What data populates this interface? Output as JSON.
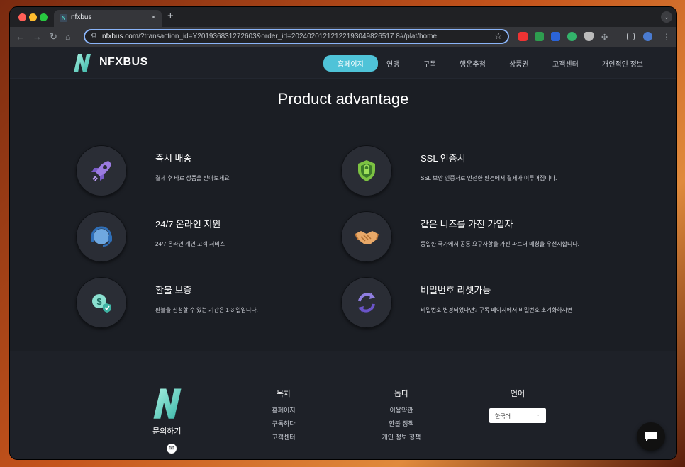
{
  "browser": {
    "tab_title": "nfxbus",
    "tab_favicon": "N",
    "url_host": "nfxbus.com",
    "url_rest": "/?transaction_id=Y201936831272603&order_id=20240201212122193049826517 8#/plat/home",
    "accent": "#8ab4f8"
  },
  "site": {
    "brand": "NFXBUS",
    "nav": [
      "홈페이지",
      "연맹",
      "구독",
      "행운추첨",
      "상품권",
      "고객센터",
      "개인적인 정보"
    ],
    "accent": "#4fc3d8"
  },
  "advantage": {
    "heading": "Product advantage",
    "features": [
      {
        "icon": "rocket-icon",
        "title": "즉시 배송",
        "desc": "결제 후 바로 상품을 받아보세요"
      },
      {
        "icon": "shield-icon",
        "title": "SSL 인증서",
        "desc": "SSL 보안 인증서로 안전한 환경에서 결제가 이루어집니다."
      },
      {
        "icon": "headset-icon",
        "title": "24/7 온라인 지원",
        "desc": "24/7 온라인 개인 고객 서비스"
      },
      {
        "icon": "handshake-icon",
        "title": "같은 니즈를 가진 가입자",
        "desc": "동일한 국가에서 공통 요구사항을 가진 파트너 매칭을 우선시합니다."
      },
      {
        "icon": "money-shield-icon",
        "title": "환불 보증",
        "desc": "환불을 신청할 수 있는 기간은 1-3 일입니다."
      },
      {
        "icon": "refresh-icon",
        "title": "비밀번호 리셋가능",
        "desc": "비밀번호 변경되었다면? 구독 페이지에서 비밀번호 초기화하시면"
      }
    ]
  },
  "footer": {
    "contact": "문의하기",
    "col1": {
      "heading": "목차",
      "links": [
        "홈페이지",
        "구독하다",
        "고객센터"
      ]
    },
    "col2": {
      "heading": "돕다",
      "links": [
        "이용약관",
        "환불 정책",
        "개인 정보 정책"
      ]
    },
    "col3": {
      "heading": "언어",
      "selected": "한국어"
    }
  }
}
